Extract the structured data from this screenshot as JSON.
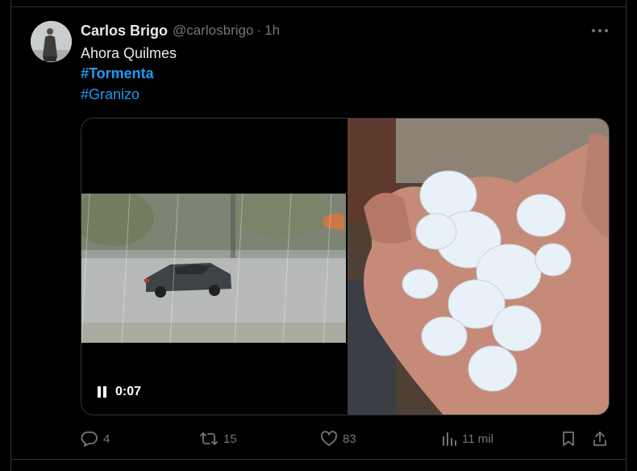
{
  "tweet": {
    "author_name": "Carlos Brigo",
    "author_handle": "@carlosbrigo",
    "separator": "·",
    "time": "1h",
    "text": "Ahora Quilmes",
    "hashtags": [
      "#Tormenta",
      "#Granizo"
    ]
  },
  "media": {
    "video_time": "0:07",
    "video_state": "playing",
    "photo_subject": "hailstones-in-hand"
  },
  "actions": {
    "replies": "4",
    "reposts": "15",
    "likes": "83",
    "views": "11 mil"
  },
  "icons": {
    "more": "more-horizontal-icon",
    "reply": "reply-icon",
    "repost": "repost-icon",
    "like": "heart-icon",
    "views": "views-chart-icon",
    "bookmark": "bookmark-icon",
    "share": "share-icon",
    "pause": "pause-icon"
  },
  "colors": {
    "background": "#000000",
    "text": "#e7e9ea",
    "muted": "#71767b",
    "link": "#1d9bf0",
    "border": "#2f3336"
  }
}
